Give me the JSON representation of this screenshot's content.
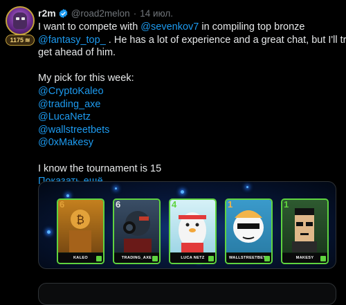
{
  "user": {
    "display_name": "r2m",
    "handle": "@road2melon",
    "date": "14 июл.",
    "badge_count": "1175",
    "badge_icon": "≋"
  },
  "tweet": {
    "line1_a": "I want to compete with ",
    "line1_mention": "@sevenkov7",
    "line1_b": "  in compiling top bronze",
    "line2_mention": "@fantasy_top_",
    "line2_b": " . He has a lot of experience and a great chat, but I'll try to",
    "line3": "get ahead of him.",
    "pick_heading": "My pick for this week:",
    "picks": [
      "@CryptoKaleo",
      "@trading_axe",
      "@LucaNetz",
      "@wallstreetbets",
      "@0xMakesy"
    ],
    "closing": "I know the tournament is 15",
    "show_more": "Показать ещё"
  },
  "cards": [
    {
      "number": "6",
      "label": "KALEO",
      "bg": "#7a4a12",
      "accent": "#e3a23a"
    },
    {
      "number": "6",
      "label": "TRADING_AXE",
      "bg": "#1d2a3a",
      "accent": "#c23a2a"
    },
    {
      "number": "4",
      "label": "LUCA NETZ",
      "bg": "#b9e6f2",
      "accent": "#f3d4c4"
    },
    {
      "number": "1",
      "label": "WALLSTREETBETS",
      "bg": "#2a7ea8",
      "accent": "#f2b44a"
    },
    {
      "number": "1",
      "label": "MAKESY",
      "bg": "#1c3a1e",
      "accent": "#e0b88a"
    }
  ],
  "colors": {
    "link": "#1d9bf0",
    "card_border": "#5fd43f",
    "verified": "#1d9bf0"
  }
}
